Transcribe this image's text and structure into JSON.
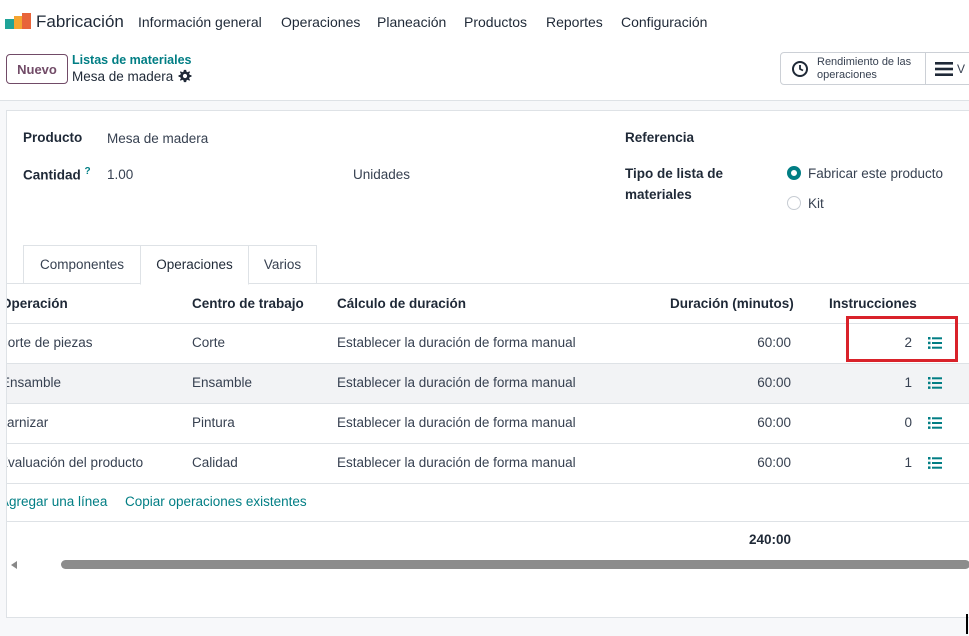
{
  "app": {
    "name": "Fabricación",
    "brand_color": "#714B67",
    "accent_color": "#017e84"
  },
  "menu": [
    "Información general",
    "Operaciones",
    "Planeación",
    "Productos",
    "Reportes",
    "Configuración"
  ],
  "control_panel": {
    "new_button": "Nuevo",
    "breadcrumb_parent": "Listas de materiales",
    "breadcrumb_current": "Mesa de madera",
    "performance_button": "Rendimiento de las operaciones",
    "view_button": "V"
  },
  "form": {
    "product_label": "Producto",
    "product_value": "Mesa de madera",
    "quantity_label": "Cantidad",
    "quantity_help": "?",
    "quantity_value": "1.00",
    "uom_value": "Unidades",
    "reference_label": "Referencia",
    "bom_type_label_1": "Tipo de lista de",
    "bom_type_label_2": "materiales",
    "bom_type_options": [
      {
        "label": "Fabricar este producto",
        "selected": true
      },
      {
        "label": "Kit",
        "selected": false
      }
    ]
  },
  "tabs": [
    {
      "label": "Componentes",
      "active": false
    },
    {
      "label": "Operaciones",
      "active": true
    },
    {
      "label": "Varios",
      "active": false
    }
  ],
  "table": {
    "columns": [
      "Operación",
      "Centro de trabajo",
      "Cálculo de duración",
      "Duración (minutos)",
      "Instrucciones"
    ],
    "rows": [
      {
        "operation": "Corte de piezas",
        "workcenter": "Corte",
        "duration_calc": "Establecer la duración de forma manual",
        "duration": "60:00",
        "instructions": "2"
      },
      {
        "operation": "Ensamble",
        "workcenter": "Ensamble",
        "duration_calc": "Establecer la duración de forma manual",
        "duration": "60:00",
        "instructions": "1"
      },
      {
        "operation": "Barnizar",
        "workcenter": "Pintura",
        "duration_calc": "Establecer la duración de forma manual",
        "duration": "60:00",
        "instructions": "0"
      },
      {
        "operation": "Evaluación del producto",
        "workcenter": "Calidad",
        "duration_calc": "Establecer la duración de forma manual",
        "duration": "60:00",
        "instructions": "1"
      }
    ],
    "add_line": "Agregar una línea",
    "copy_operations": "Copiar operaciones existentes",
    "total_duration": "240:00"
  },
  "icons": [
    "app-logo-icon",
    "gear-icon",
    "clock-icon",
    "bars-icon",
    "list-icon",
    "scroll-left-icon"
  ]
}
